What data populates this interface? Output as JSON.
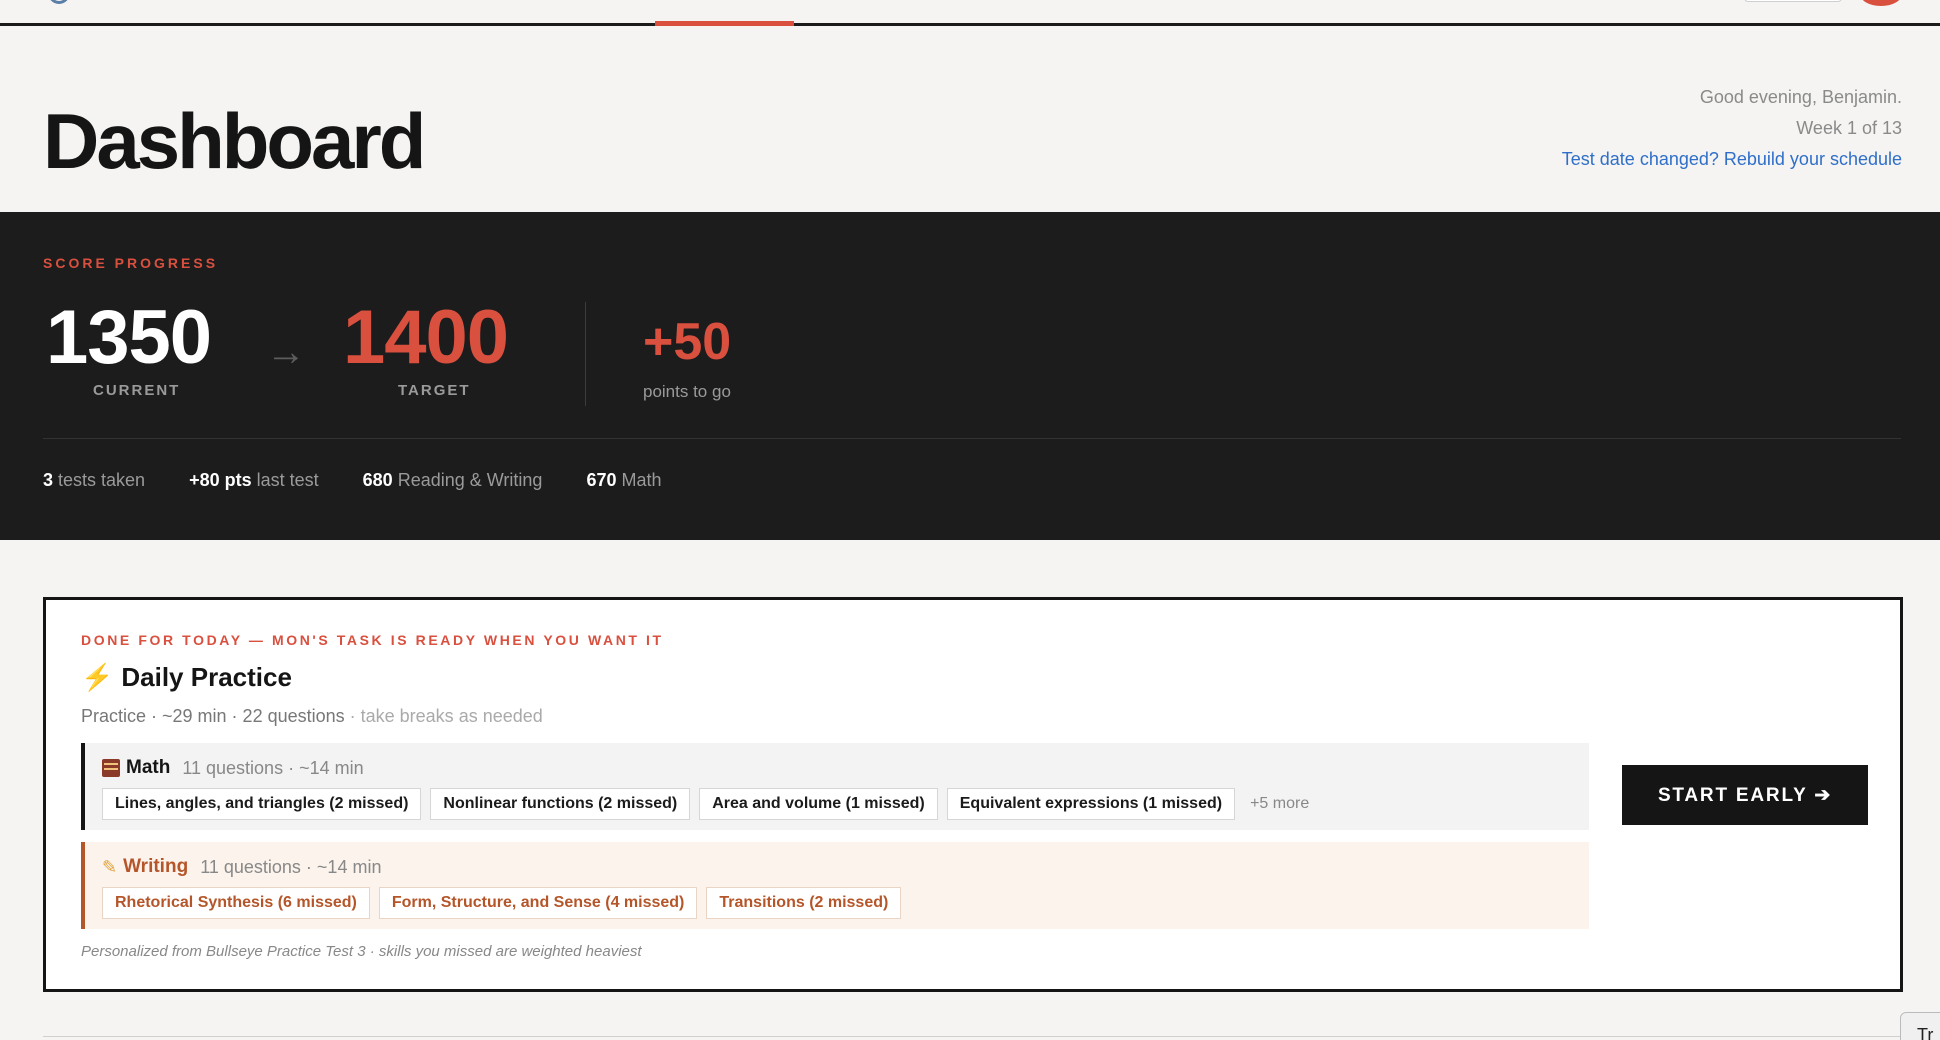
{
  "header": {
    "title": "Dashboard",
    "greeting": "Good evening, Benjamin.",
    "week": "Week 1 of 13",
    "rebuild_link": "Test date changed? Rebuild your schedule"
  },
  "score": {
    "eyebrow": "SCORE PROGRESS",
    "current": "1350",
    "current_label": "CURRENT",
    "target": "1400",
    "target_label": "TARGET",
    "delta": "+50",
    "delta_label": "points to go",
    "stats": [
      {
        "value": "3",
        "label": " tests taken"
      },
      {
        "value": "+80 pts",
        "label": " last test"
      },
      {
        "value": "680",
        "label": " Reading & Writing"
      },
      {
        "value": "670",
        "label": " Math"
      }
    ]
  },
  "practice": {
    "eyebrow": "DONE FOR TODAY — MON'S TASK IS READY WHEN YOU WANT IT",
    "title": "Daily Practice",
    "meta": "Practice · ~29 min · 22 questions",
    "meta_soft": " · take breaks as needed",
    "math": {
      "name": "Math",
      "info": "11 questions · ~14 min",
      "chips": [
        "Lines, angles, and triangles (2 missed)",
        "Nonlinear functions (2 missed)",
        "Area and volume (1 missed)",
        "Equivalent expressions (1 missed)"
      ],
      "more": "+5 more"
    },
    "writing": {
      "name": "Writing",
      "info": "11 questions · ~14 min",
      "chips": [
        "Rhetorical Synthesis (6 missed)",
        "Form, Structure, and Sense (4 missed)",
        "Transitions (2 missed)"
      ]
    },
    "start_button": "START EARLY ➔",
    "footnote": "Personalized from Bullseye Practice Test 3 · skills you missed are weighted heaviest"
  },
  "corner_tab": "Tr",
  "colors": {
    "accent": "#d9503f",
    "link": "#2f6fc9",
    "panel": "#1c1c1c",
    "writing": "#b5562a"
  }
}
